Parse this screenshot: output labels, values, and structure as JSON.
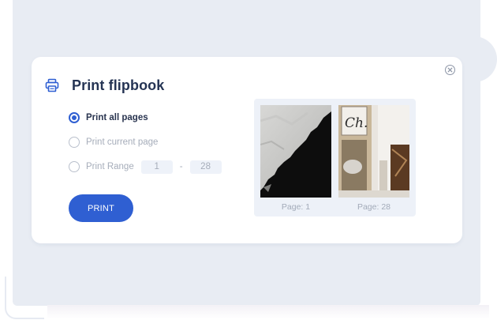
{
  "dialog": {
    "title": "Print flipbook",
    "icon": "printer-icon",
    "close_icon": "close-icon",
    "options": [
      {
        "label": "Print all pages",
        "selected": true
      },
      {
        "label": "Print current page",
        "selected": false
      },
      {
        "label": "Print Range",
        "selected": false
      }
    ],
    "range": {
      "from": "1",
      "separator": "-",
      "to": "28"
    },
    "print_button": "PRINT"
  },
  "preview": {
    "pages": [
      {
        "label": "Page: 1"
      },
      {
        "label": "Page: 28"
      }
    ]
  },
  "colors": {
    "accent": "#2f5fd2",
    "title": "#253454",
    "muted_text": "#a6adba",
    "background": "#e8ecf3"
  }
}
